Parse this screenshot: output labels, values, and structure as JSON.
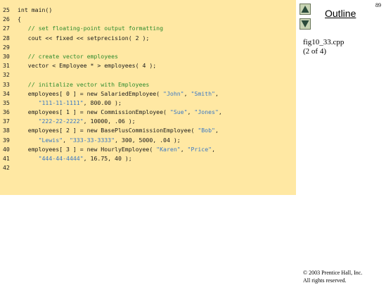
{
  "page_number": "89",
  "outline": {
    "title": "Outline",
    "file": "fig10_33.cpp",
    "part": "(2 of 4)"
  },
  "code_lines": [
    {
      "n": "25",
      "segs": [
        {
          "t": "int main()",
          "c": "plain"
        }
      ]
    },
    {
      "n": "26",
      "segs": [
        {
          "t": "{",
          "c": "plain"
        }
      ]
    },
    {
      "n": "27",
      "segs": [
        {
          "t": "   // set floating-point output formatting",
          "c": "comment"
        }
      ]
    },
    {
      "n": "28",
      "segs": [
        {
          "t": "   cout << fixed << setprecision( 2 );",
          "c": "plain"
        }
      ]
    },
    {
      "n": "29",
      "segs": []
    },
    {
      "n": "30",
      "segs": [
        {
          "t": "   // create vector employees",
          "c": "comment"
        }
      ]
    },
    {
      "n": "31",
      "segs": [
        {
          "t": "   vector < Employee * > employees( 4 );",
          "c": "plain"
        }
      ]
    },
    {
      "n": "32",
      "segs": []
    },
    {
      "n": "33",
      "segs": [
        {
          "t": "   // initialize vector with Employees",
          "c": "comment"
        }
      ]
    },
    {
      "n": "34",
      "segs": [
        {
          "t": "   employees[ 0 ] = new SalariedEmployee( ",
          "c": "plain"
        },
        {
          "t": "\"John\"",
          "c": "string"
        },
        {
          "t": ", ",
          "c": "plain"
        },
        {
          "t": "\"Smith\"",
          "c": "string"
        },
        {
          "t": ",",
          "c": "plain"
        }
      ]
    },
    {
      "n": "35",
      "segs": [
        {
          "t": "      ",
          "c": "plain"
        },
        {
          "t": "\"111-11-1111\"",
          "c": "string"
        },
        {
          "t": ", 800.00 );",
          "c": "plain"
        }
      ]
    },
    {
      "n": "36",
      "segs": [
        {
          "t": "   employees[ 1 ] = new CommissionEmployee( ",
          "c": "plain"
        },
        {
          "t": "\"Sue\"",
          "c": "string"
        },
        {
          "t": ", ",
          "c": "plain"
        },
        {
          "t": "\"Jones\"",
          "c": "string"
        },
        {
          "t": ",",
          "c": "plain"
        }
      ]
    },
    {
      "n": "37",
      "segs": [
        {
          "t": "      ",
          "c": "plain"
        },
        {
          "t": "\"222-22-2222\"",
          "c": "string"
        },
        {
          "t": ", 10000, .06 );",
          "c": "plain"
        }
      ]
    },
    {
      "n": "38",
      "segs": [
        {
          "t": "   employees[ 2 ] = new BasePlusCommissionEmployee( ",
          "c": "plain"
        },
        {
          "t": "\"Bob\"",
          "c": "string"
        },
        {
          "t": ",",
          "c": "plain"
        }
      ]
    },
    {
      "n": "39",
      "segs": [
        {
          "t": "      ",
          "c": "plain"
        },
        {
          "t": "\"Lewis\"",
          "c": "string"
        },
        {
          "t": ", ",
          "c": "plain"
        },
        {
          "t": "\"333-33-3333\"",
          "c": "string"
        },
        {
          "t": ", 300, 5000, .04 );",
          "c": "plain"
        }
      ]
    },
    {
      "n": "40",
      "segs": [
        {
          "t": "   employees[ 3 ] = new HourlyEmployee( ",
          "c": "plain"
        },
        {
          "t": "\"Karen\"",
          "c": "string"
        },
        {
          "t": ", ",
          "c": "plain"
        },
        {
          "t": "\"Price\"",
          "c": "string"
        },
        {
          "t": ",",
          "c": "plain"
        }
      ]
    },
    {
      "n": "41",
      "segs": [
        {
          "t": "      ",
          "c": "plain"
        },
        {
          "t": "\"444-44-4444\"",
          "c": "string"
        },
        {
          "t": ", 16.75, 40 );",
          "c": "plain"
        }
      ]
    },
    {
      "n": "42",
      "segs": []
    }
  ],
  "copyright": {
    "line1": "© 2003 Prentice Hall, Inc.",
    "line2": "All rights reserved."
  },
  "colors": {
    "code_background": "#ffe8a3",
    "comment": "#2e8b2e",
    "string": "#3a78c4"
  },
  "icons": {
    "up": "triangle-up-icon",
    "down": "triangle-down-icon"
  }
}
